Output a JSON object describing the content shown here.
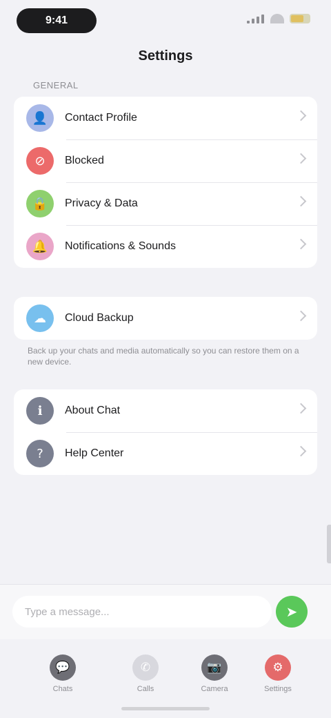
{
  "status_bar": {
    "time": "9:41"
  },
  "nav": {
    "title": "Settings"
  },
  "sections": [
    {
      "header": "GENERAL",
      "items": [
        {
          "label": "Contact Profile",
          "icon": "person-icon",
          "glyph": "👤",
          "color": "#a8b8e8"
        },
        {
          "label": "Blocked",
          "icon": "block-icon",
          "glyph": "⊘",
          "color": "#ec6a6a"
        },
        {
          "label": "Privacy & Data",
          "icon": "lock-icon",
          "glyph": "🔒",
          "color": "#8fd06e"
        },
        {
          "label": "Notifications & Sounds",
          "icon": "bell-icon",
          "glyph": "🔔",
          "color": "#eaa6c8"
        }
      ]
    },
    {
      "header": "",
      "items": [
        {
          "label": "Cloud Backup",
          "icon": "cloud-icon",
          "glyph": "☁",
          "color": "#78c0ee"
        }
      ],
      "footnote": "Back up your chats and media automatically so you can restore them on a new device."
    },
    {
      "header": "",
      "items": [
        {
          "label": "About Chat",
          "icon": "info-icon",
          "glyph": "ℹ",
          "color": "#7a7f90"
        },
        {
          "label": "Help Center",
          "icon": "help-icon",
          "glyph": "?",
          "color": "#7a7f90"
        }
      ]
    }
  ],
  "composer": {
    "placeholder": "Type a message...",
    "send_icon": "send-icon"
  },
  "tabs": [
    {
      "label": "Chats",
      "icon": "chat-icon",
      "glyph": "💬",
      "color": "#6e6e75"
    },
    {
      "label": "Calls",
      "icon": "phone-icon",
      "glyph": "✆",
      "color": "#d8d8de"
    },
    {
      "label": "Camera",
      "icon": "camera-icon",
      "glyph": "📷",
      "color": "#6e6e75"
    },
    {
      "label": "Settings",
      "icon": "gear-icon",
      "glyph": "⚙",
      "color": "#e46a6a"
    }
  ]
}
